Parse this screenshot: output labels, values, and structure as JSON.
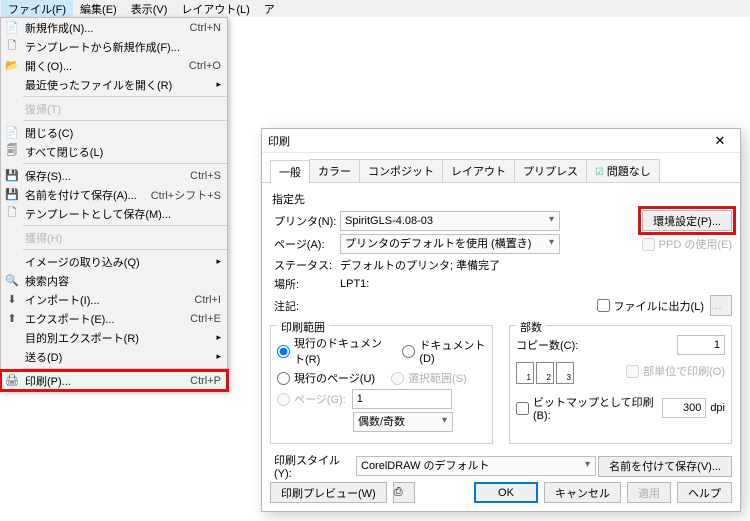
{
  "menubar": {
    "file": "ファイル(F)",
    "edit": "編集(E)",
    "view": "表示(V)",
    "layout": "レイアウト(L)",
    "arr": "ア"
  },
  "fileMenu": {
    "new": "新規作成(N)...",
    "new_sc": "Ctrl+N",
    "newTmpl": "テンプレートから新規作成(F)...",
    "open": "開く(O)...",
    "open_sc": "Ctrl+O",
    "recent": "最近使ったファイルを開く(R)",
    "revert": "復帰(T)",
    "close": "閉じる(C)",
    "closeAll": "すべて閉じる(L)",
    "save": "保存(S)...",
    "save_sc": "Ctrl+S",
    "saveAs": "名前を付けて保存(A)...",
    "saveAs_sc": "Ctrl+シフト+S",
    "saveTmpl": "テンプレートとして保存(M)...",
    "acquire": "獲得(H)",
    "imgImport": "イメージの取り込み(Q)",
    "search": "検索内容",
    "import": "インポート(I)...",
    "import_sc": "Ctrl+I",
    "export": "エクスポート(E)...",
    "export_sc": "Ctrl+E",
    "exportFor": "目的別エクスポート(R)",
    "send": "送る(D)",
    "print": "印刷(P)...",
    "print_sc": "Ctrl+P"
  },
  "dlg": {
    "title": "印刷",
    "tabs": {
      "general": "一般",
      "color": "カラー",
      "composite": "コンポジット",
      "layout": "レイアウト",
      "prepress": "プリプレス",
      "noissue": "問題なし"
    },
    "dest": {
      "legend": "指定先",
      "printer_l": "プリンタ(N):",
      "printer_v": "SpiritGLS-4.08-03",
      "prefs": "環境設定(P)...",
      "page_l": "ページ(A):",
      "page_v": "プリンタのデフォルトを使用 (横置き)",
      "ppd": "PPD の使用(E)",
      "status_l": "ステータス:",
      "status_v": "デフォルトのプリンタ; 準備完了",
      "where_l": "場所:",
      "where_v": "LPT1:",
      "comment_l": "注記:",
      "tofile": "ファイルに出力(L)"
    },
    "range": {
      "legend": "印刷範囲",
      "curdoc": "現行のドキュメント(R)",
      "docs": "ドキュメント(D)",
      "curpage": "現行のページ(U)",
      "sel": "選択範囲(S)",
      "pages": "ページ(G):",
      "pages_v": "1",
      "evenodd": "偶数/奇数"
    },
    "copies": {
      "legend": "部数",
      "count_l": "コピー数(C):",
      "count_v": "1",
      "collate": "部単位で印刷(O)"
    },
    "bitmap_l": "ビットマップとして印刷(B):",
    "bitmap_v": "300",
    "bitmap_u": "dpi",
    "style_l": "印刷スタイル(Y):",
    "style_v": "CorelDRAW のデフォルト",
    "style_save": "名前を付けて保存(V)...",
    "buttons": {
      "preview": "印刷プレビュー(W)",
      "ok": "OK",
      "cancel": "キャンセル",
      "apply": "適用",
      "help": "ヘルプ"
    }
  }
}
